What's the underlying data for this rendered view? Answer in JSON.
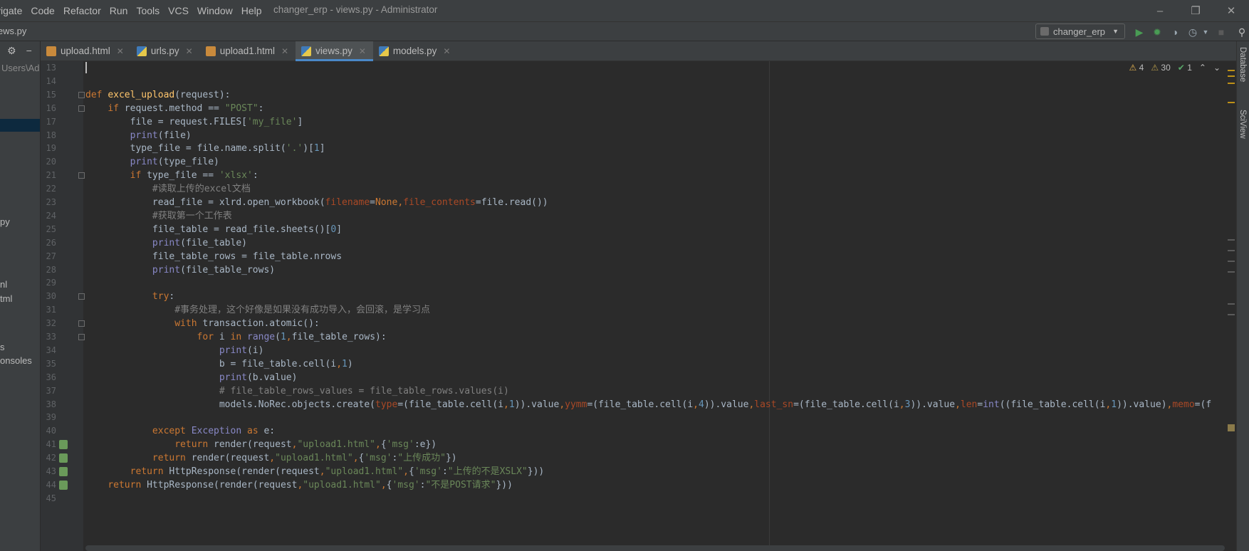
{
  "menu": {
    "items": [
      "vigate",
      "Code",
      "Refactor",
      "Run",
      "Tools",
      "VCS",
      "Window",
      "Help"
    ],
    "title": "changer_erp - views.py - Administrator"
  },
  "navbar": {
    "breadcrumb": "iews.py",
    "run_config": "changer_erp"
  },
  "project_panel": {
    "path_fragment": "Users\\Adr",
    "fragments": [
      "py",
      "nl",
      "tml",
      "s",
      "onsoles"
    ]
  },
  "tabs": [
    {
      "label": "upload.html",
      "type": "html"
    },
    {
      "label": "urls.py",
      "type": "py"
    },
    {
      "label": "upload1.html",
      "type": "html"
    },
    {
      "label": "views.py",
      "type": "py",
      "active": true
    },
    {
      "label": "models.py",
      "type": "py"
    }
  ],
  "inspections": {
    "warnings": "4",
    "weak_warnings": "30",
    "ok": "1"
  },
  "right_tools": [
    "Database",
    "SciView"
  ],
  "editor": {
    "line_numbers": [
      "13",
      "14",
      "15",
      "16",
      "17",
      "18",
      "19",
      "20",
      "21",
      "22",
      "23",
      "24",
      "25",
      "26",
      "27",
      "28",
      "29",
      "30",
      "31",
      "32",
      "33",
      "34",
      "35",
      "36",
      "37",
      "38",
      "39",
      "40",
      "41",
      "42",
      "43",
      "44",
      "45"
    ],
    "code": [
      "",
      "",
      "def excel_upload(request):",
      "    if request.method == \"POST\":",
      "        file = request.FILES['my_file']",
      "        print(file)",
      "        type_file = file.name.split('.')[1]",
      "        print(type_file)",
      "        if type_file == 'xlsx':",
      "            #读取上传的excel文档",
      "            read_file = xlrd.open_workbook(filename=None,file_contents=file.read())",
      "            #获取第一个工作表",
      "            file_table = read_file.sheets()[0]",
      "            print(file_table)",
      "            file_table_rows = file_table.nrows",
      "            print(file_table_rows)",
      "",
      "            try:",
      "                #事务处理，这个好像是如果没有成功导入，会回滚，是学习点",
      "                with transaction.atomic():",
      "                    for i in range(1,file_table_rows):",
      "                        print(i)",
      "                        b = file_table.cell(i,1)",
      "                        print(b.value)",
      "                        # file_table_rows_values = file_table_rows.values(i)",
      "                        models.NoRec.objects.create(type=(file_table.cell(i,1)).value,yymm=(file_table.cell(i,4)).value,last_sn=(file_table.cell(i,3)).value,len=int((file_table.cell(i,1)).value),memo=(f",
      "",
      "            except Exception as e:",
      "                return render(request,\"upload1.html\",{'msg':e})",
      "            return render(request,\"upload1.html\",{'msg':\"上传成功\"})",
      "        return HttpResponse(render(request,\"upload1.html\",{'msg':\"上传的不是XSLX\"}))",
      "    return HttpResponse(render(request,\"upload1.html\",{'msg':\"不是POST请求\"}))",
      ""
    ]
  }
}
